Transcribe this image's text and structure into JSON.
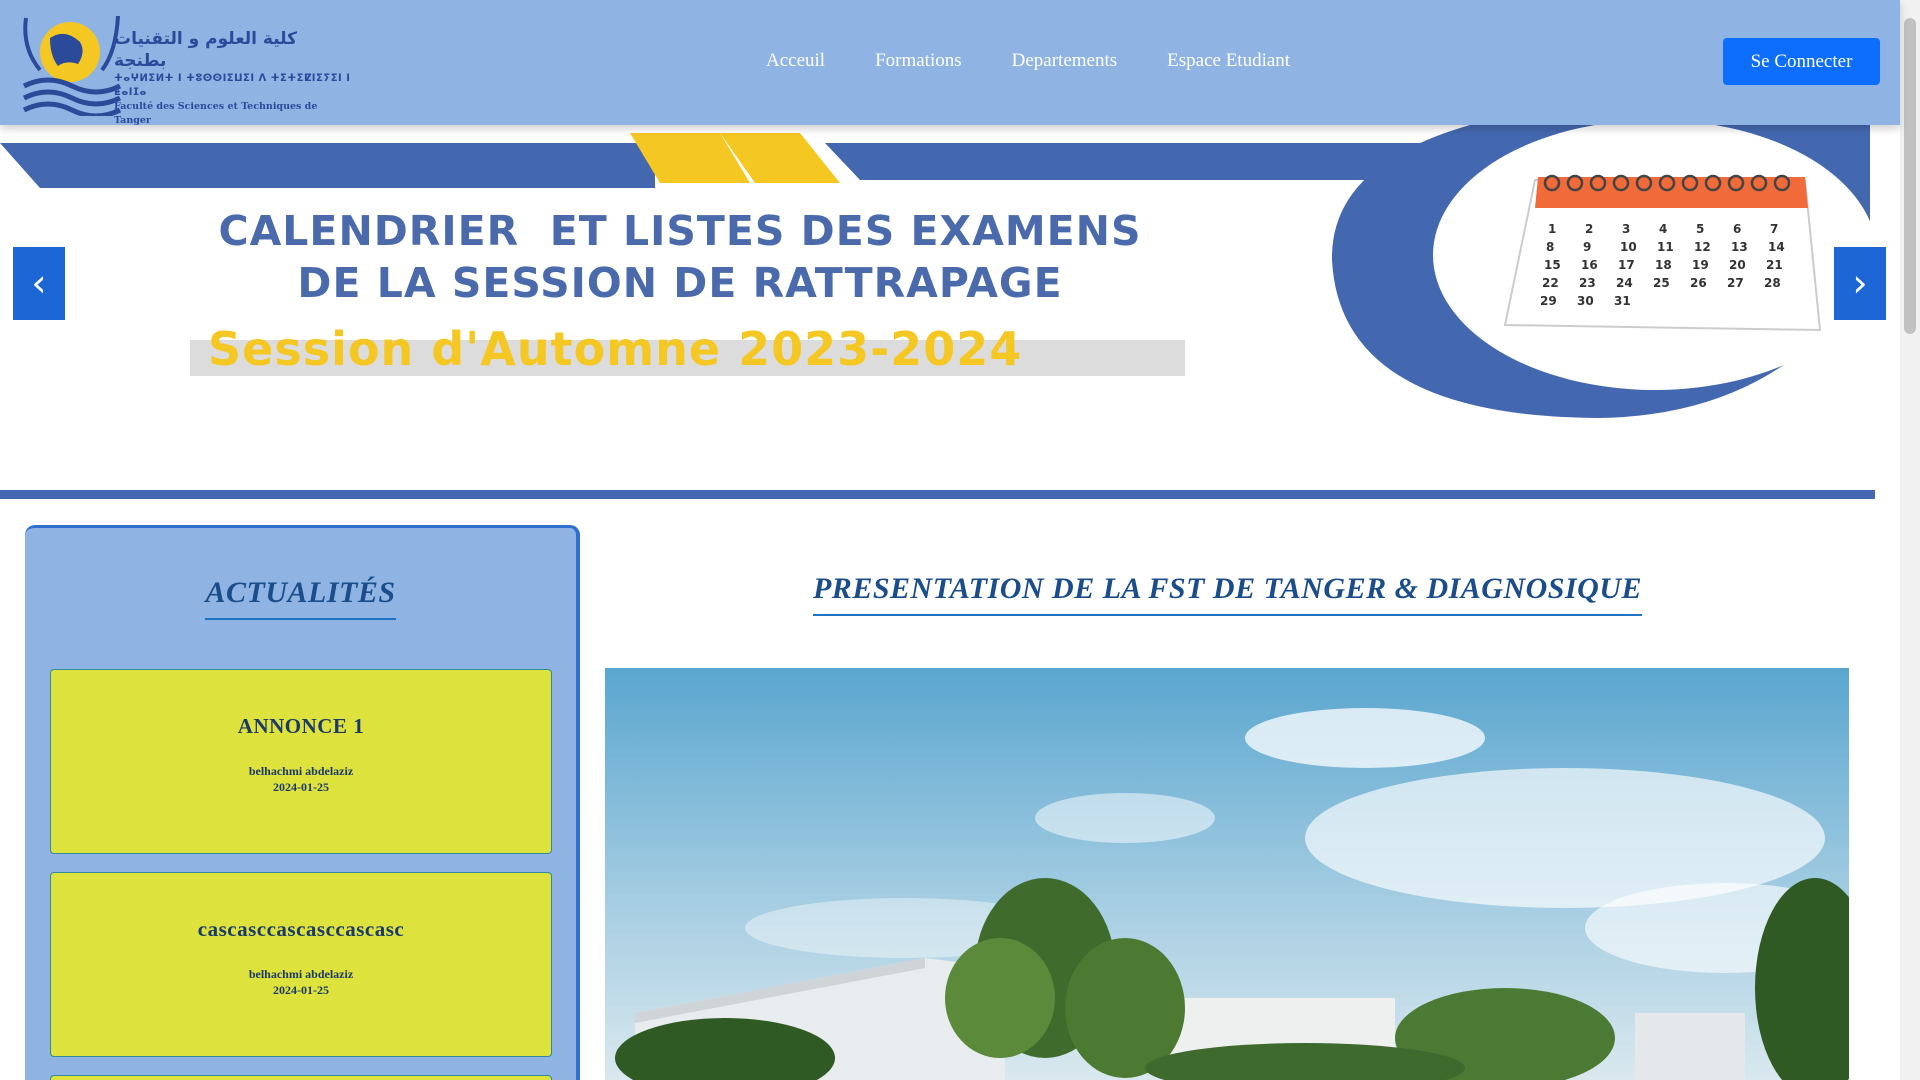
{
  "header": {
    "logo": {
      "arabic": "كلية العلوم و التقنيات بطنجة",
      "tifinagh": "ⵜⴰⵖⵍⵉⵍⵜ ⵏ ⵜⵓⵙⵙⵏⵉⵡⵉⵏ ⴷ ⵜⵉⵜⵉⵇⵏⵉⵢⵉⵏ ⵏ ⵟⴰⵏⵊⴰ",
      "french": "Faculté des Sciences et Techniques de Tanger"
    },
    "nav": [
      "Acceuil",
      "Formations",
      "Departements",
      "Espace Etudiant"
    ],
    "login_label": "Se Connecter"
  },
  "banner": {
    "title_line1": "CALENDRIER  ET LISTES DES EXAMENS",
    "title_line2": "DE LA SESSION DE RATTRAPAGE",
    "session": "Session d'Automne 2023-2024",
    "calendar_days": [
      "1",
      "2",
      "3",
      "4",
      "5",
      "6",
      "7",
      "8",
      "9",
      "10",
      "11",
      "12",
      "13",
      "14",
      "15",
      "16",
      "17",
      "18",
      "19",
      "20",
      "21",
      "22",
      "23",
      "24",
      "25",
      "26",
      "27",
      "28",
      "29",
      "30",
      "31"
    ],
    "prev_label": "‹",
    "next_label": "›"
  },
  "actualites": {
    "title": "ACTUALITÉS",
    "items": [
      {
        "title": "ANNONCE 1",
        "author": "belhachmi abdelaziz",
        "date": "2024-01-25"
      },
      {
        "title": "cascasccascasccascasc",
        "author": "belhachmi abdelaziz",
        "date": "2024-01-25"
      }
    ]
  },
  "presentation": {
    "title": "PRESENTATION DE LA FST DE TANGER & DIAGNOSIQUE"
  },
  "colors": {
    "header_bg": "#8fb3e3",
    "primary_button": "#0d6efd",
    "banner_blue": "#4468b0",
    "banner_yellow": "#f5c723",
    "annonce_bg": "#dde23c",
    "title_blue": "#1b4d8a"
  }
}
